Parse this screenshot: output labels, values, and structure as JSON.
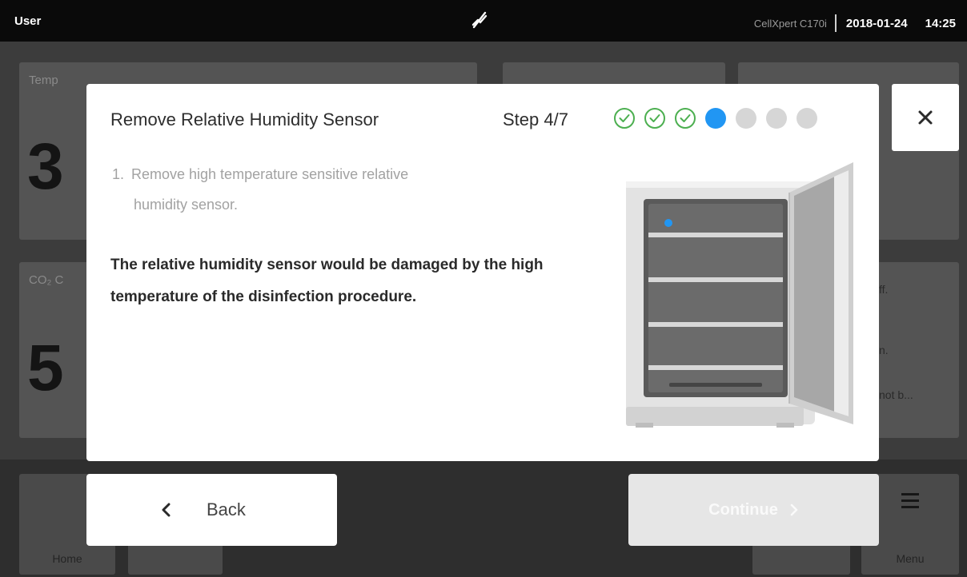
{
  "status_bar": {
    "user": "User",
    "device": "CellXpert C170i",
    "date": "2018-01-24",
    "time": "14:25",
    "network_icon": "network-disconnected-icon"
  },
  "background": {
    "tiles": {
      "temperature_label": "Temp",
      "temperature_value": "3",
      "co2_label": "CO₂ C",
      "co2_value": "5",
      "side_text_1": "ff.",
      "side_text_2": "n.",
      "side_text_3": "not b..."
    },
    "nav": {
      "home": "Home",
      "menu": "Menu"
    }
  },
  "dialog": {
    "title": "Remove Relative Humidity Sensor",
    "step_label": "Step 4/7",
    "steps_total": 7,
    "current_step": 4,
    "instruction_number": "1.",
    "instruction_line1": "Remove high temperature sensitive relative",
    "instruction_line2": "humidity sensor.",
    "warning": "The relative humidity sensor would be damaged by the high temperature of the disinfection procedure.",
    "close_icon": "close-icon"
  },
  "buttons": {
    "back": "Back",
    "continue": "Continue"
  },
  "colors": {
    "step_done": "#4caf50",
    "step_current": "#2196f3",
    "step_todo": "#d6d6d6",
    "continue_disabled": "#e6e6e6"
  }
}
